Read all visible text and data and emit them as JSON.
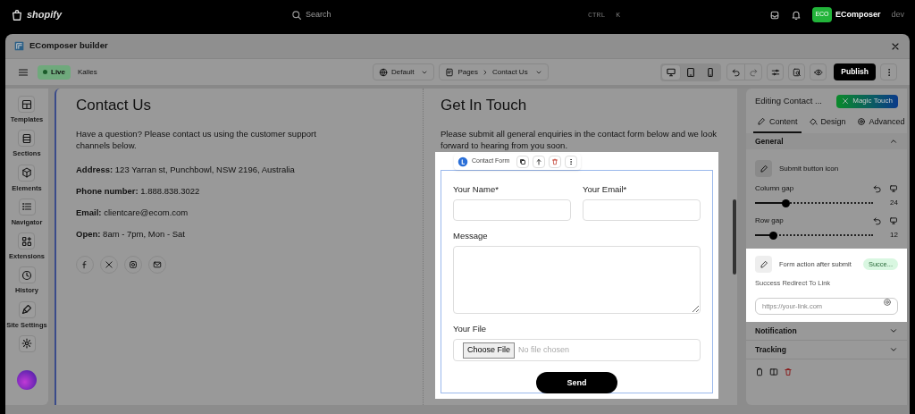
{
  "topbar": {
    "brand": "shopify",
    "search": {
      "placeholder": "Search"
    },
    "shortcut": [
      "CTRL",
      "K"
    ],
    "avatar": "ECO",
    "store": "EComposer",
    "store_suffix": "dev"
  },
  "window": {
    "title": "EComposer builder"
  },
  "toolbar": {
    "status": "Live",
    "store": "Kalles",
    "theme": "Default",
    "breadcrumb": [
      "Pages",
      "Contact Us"
    ],
    "devices": [
      {
        "kind": "desktop",
        "selected": true
      },
      {
        "kind": "tablet",
        "selected": false
      },
      {
        "kind": "mobile",
        "selected": false
      }
    ],
    "publish": "Publish"
  },
  "sidebar": {
    "items": [
      {
        "kind": "templates",
        "label": "Templates"
      },
      {
        "kind": "sections",
        "label": "Sections"
      },
      {
        "kind": "elements",
        "label": "Elements"
      },
      {
        "kind": "navigator",
        "label": "Navigator"
      },
      {
        "kind": "extensions",
        "label": "Extensions"
      },
      {
        "kind": "history",
        "label": "History"
      },
      {
        "kind": "site",
        "label": "Site Settings"
      },
      {
        "kind": "settings"
      }
    ]
  },
  "contact": {
    "heading": "Contact Us",
    "intro": "Have a question? Please contact us using the customer support channels below.",
    "details": [
      {
        "label": "Address:",
        "value": "123 Yarran st, Punchbowl, NSW 2196, Australia"
      },
      {
        "label": "Phone number:",
        "value": "1.888.838.3022"
      },
      {
        "label": "Email:",
        "value": "clientcare@ecom.com"
      },
      {
        "label": "Open:",
        "value": "8am - 7pm, Mon - Sat"
      }
    ],
    "socials": [
      {
        "kind": "facebook"
      },
      {
        "kind": "x"
      },
      {
        "kind": "instagram"
      },
      {
        "kind": "mail"
      }
    ]
  },
  "touch": {
    "heading": "Get In Touch",
    "intro": "Please submit all general enquiries in the contact form below and we look forward to hearing from you soon.",
    "element_label": "Contact Form",
    "fields": [
      {
        "kind": "input",
        "label": "Your Name*"
      },
      {
        "kind": "input",
        "label": "Your Email*"
      },
      {
        "kind": "textarea",
        "label": "Message"
      },
      {
        "kind": "file",
        "label": "Your File",
        "button": "Choose File",
        "status": "No file chosen"
      }
    ],
    "submit": "Send"
  },
  "panel": {
    "title": "Editing Contact ...",
    "magic": "Magic Touch",
    "tabs": [
      {
        "kind": "content",
        "label": "Content",
        "selected": true
      },
      {
        "kind": "design",
        "label": "Design",
        "selected": false
      },
      {
        "kind": "advanced",
        "label": "Advanced",
        "selected": false
      }
    ],
    "general": {
      "label": "General",
      "expanded": true
    },
    "submit_icon": "Submit button icon",
    "sliders": [
      {
        "label": "Column gap",
        "level": 0.26,
        "reading": "24"
      },
      {
        "label": "Row gap",
        "level": 0.15,
        "reading": "12"
      }
    ],
    "action": {
      "label": "Form action after submit",
      "badge": "Succe..."
    },
    "redirect": {
      "label": "Success Redirect To Link",
      "placeholder": "https://your-link.com"
    },
    "sections": [
      {
        "label": "Notification",
        "expanded": false
      },
      {
        "label": "Tracking",
        "expanded": false
      }
    ]
  }
}
